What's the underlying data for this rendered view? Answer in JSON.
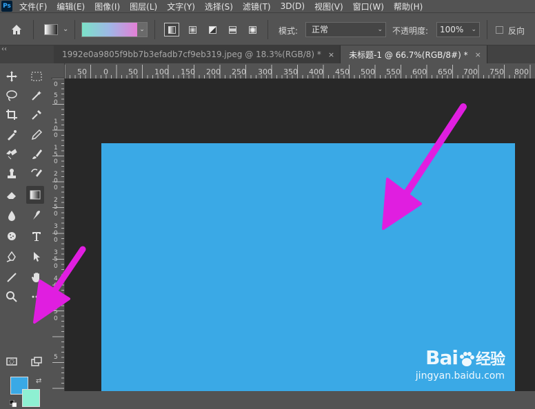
{
  "menubar": {
    "logo": "Ps",
    "items": [
      "文件(F)",
      "编辑(E)",
      "图像(I)",
      "图层(L)",
      "文字(Y)",
      "选择(S)",
      "滤镜(T)",
      "3D(D)",
      "视图(V)",
      "窗口(W)",
      "帮助(H)"
    ]
  },
  "options": {
    "mode_label": "模式:",
    "mode_value": "正常",
    "opacity_label": "不透明度:",
    "opacity_value": "100%",
    "reverse_label": "反向"
  },
  "tabs": [
    {
      "title": "1992e0a9805f9bb7b3efadb7cf9eb319.jpeg @ 18.3%(RGB/8) *",
      "close": "×"
    },
    {
      "title": "未标题-1 @ 66.7%(RGB/8#) *",
      "close": "×"
    }
  ],
  "panel_toggle": "‹‹",
  "ruler_top_labels": [
    "50",
    "0",
    "50",
    "100",
    "150",
    "200",
    "250",
    "300",
    "350",
    "400",
    "450",
    "500",
    "550",
    "600",
    "650",
    "700",
    "750",
    "800"
  ],
  "ruler_left_labels": [
    "0",
    "5",
    "0",
    "1",
    "0",
    "0",
    "1",
    "5",
    "0",
    "2",
    "0",
    "0",
    "2",
    "5",
    "0",
    "3",
    "0",
    "0",
    "3",
    "5",
    "0",
    "4",
    "0",
    "0",
    "4",
    "5",
    "0",
    "5"
  ],
  "colors": {
    "foreground": "#3aa9e6",
    "background": "#8ef0d2",
    "canvas_fill": "#3aa9e6",
    "annotation_arrow": "#e01ee0"
  },
  "watermark": {
    "logo_bai": "Bai",
    "logo_du": "du",
    "logo_suffix": "经验",
    "url": "jingyan.baidu.com"
  }
}
